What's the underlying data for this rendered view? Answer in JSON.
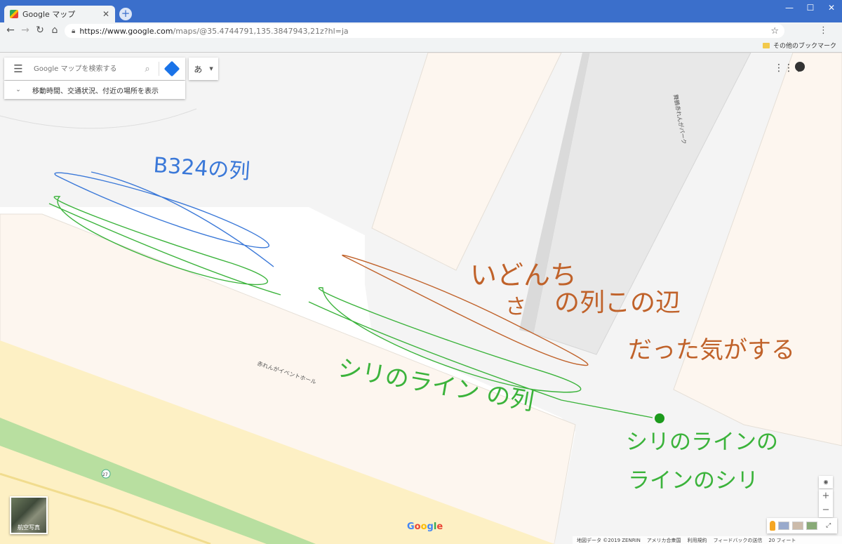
{
  "browser": {
    "tab_title": "Google マップ",
    "tab_close": "✕",
    "new_tab": "+",
    "url_host": "https://www.google.com",
    "url_path": "/maps/@35.4744791,135.3847943,21z?hl=ja",
    "bookmark_other": "その他のブックマーク"
  },
  "map_ui": {
    "search_placeholder": "Google マップを検索する",
    "language_button": "あ",
    "explore_text": "移動時間、交通状況、付近の場所を表示",
    "satellite_label": "航空写真",
    "logo": "Google",
    "route_badge": "27"
  },
  "map_labels": {
    "venue": "赤れんがイベントホール",
    "park_road": "舞鶴赤れんがパーク"
  },
  "annotations": {
    "blue_text": "B324の列",
    "orange_text_line1": "いどんち",
    "orange_text_line2": "の列この辺",
    "orange_text_line3": "だった気がする",
    "orange_small": "さ",
    "green_text_main": "シリのライン の列",
    "green_text_right_line1": "シリのラインの",
    "green_text_right_line2": "ラインのシリ",
    "colors": {
      "blue": "#3a78d8",
      "green": "#3bb33b",
      "orange": "#c0622a"
    }
  },
  "footer": {
    "map_data": "地図データ ©2019 ZENRIN",
    "country": "アメリカ合衆国",
    "terms": "利用規約",
    "feedback": "フィードバックの送信",
    "scale": "20 フィート"
  }
}
